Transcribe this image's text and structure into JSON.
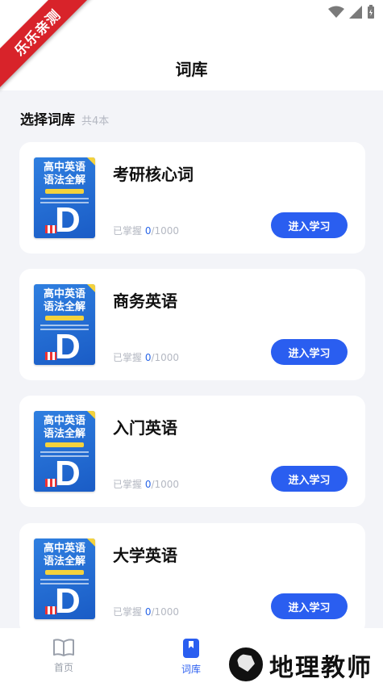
{
  "ribbon": {
    "text": "乐乐亲测"
  },
  "header": {
    "title": "词库"
  },
  "section": {
    "title": "选择词库",
    "count": "共4本"
  },
  "cover": {
    "line1": "高中英语",
    "line2": "语法全解",
    "letter": "D"
  },
  "books": [
    {
      "name": "考研核心词",
      "progress_label": "已掌握",
      "mastered": "0",
      "total": "/1000",
      "button": "进入学习"
    },
    {
      "name": "商务英语",
      "progress_label": "已掌握",
      "mastered": "0",
      "total": "/1000",
      "button": "进入学习"
    },
    {
      "name": "入门英语",
      "progress_label": "已掌握",
      "mastered": "0",
      "total": "/1000",
      "button": "进入学习"
    },
    {
      "name": "大学英语",
      "progress_label": "已掌握",
      "mastered": "0",
      "total": "/1000",
      "button": "进入学习"
    }
  ],
  "tabbar": {
    "home": {
      "label": "首页",
      "icon": "book-open-icon"
    },
    "library": {
      "label": "词库",
      "icon": "bookmark-icon",
      "active": true
    }
  },
  "watermark": {
    "text": "地理教师"
  },
  "colors": {
    "accent": "#2a5ef0",
    "background": "#f3f4f8",
    "ribbon": "#d8232a"
  }
}
